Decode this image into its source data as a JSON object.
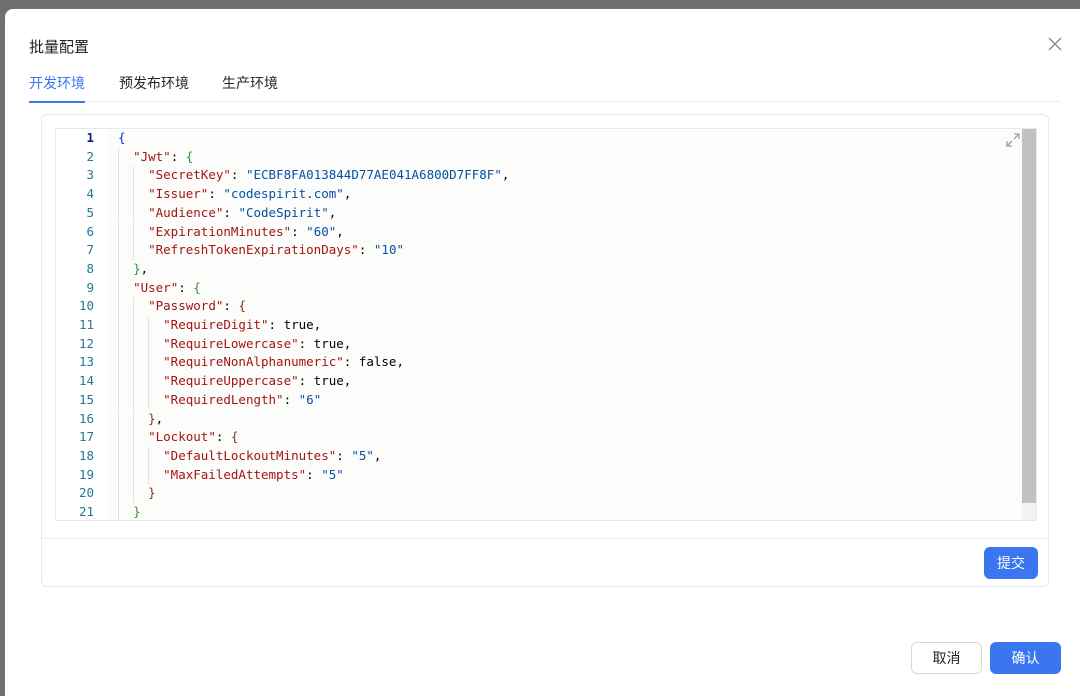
{
  "dialog": {
    "title": "批量配置",
    "close_icon": "close-icon"
  },
  "tabs": [
    {
      "label": "开发环境",
      "active": true
    },
    {
      "label": "预发布环境",
      "active": false
    },
    {
      "label": "生产环境",
      "active": false
    }
  ],
  "editor": {
    "language": "json",
    "expand_icon": "expand-icon",
    "line_numbers": [
      "1",
      "2",
      "3",
      "4",
      "5",
      "6",
      "7",
      "8",
      "9",
      "10",
      "11",
      "12",
      "13",
      "14",
      "15",
      "16",
      "17",
      "18",
      "19",
      "20",
      "21"
    ],
    "lines": [
      "{",
      "  \"Jwt\": {",
      "    \"SecretKey\": \"ECBF8FA013844D77AE041A6800D7FF8F\",",
      "    \"Issuer\": \"codespirit.com\",",
      "    \"Audience\": \"CodeSpirit\",",
      "    \"ExpirationMinutes\": \"60\",",
      "    \"RefreshTokenExpirationDays\": \"10\"",
      "  },",
      "  \"User\": {",
      "    \"Password\": {",
      "      \"RequireDigit\": true,",
      "      \"RequireLowercase\": true,",
      "      \"RequireNonAlphanumeric\": false,",
      "      \"RequireUppercase\": true,",
      "      \"RequiredLength\": \"6\"",
      "    },",
      "    \"Lockout\": {",
      "      \"DefaultLockoutMinutes\": \"5\",",
      "      \"MaxFailedAttempts\": \"5\"",
      "    }",
      "  }"
    ]
  },
  "card": {
    "submit_label": "提交"
  },
  "footer": {
    "cancel_label": "取消",
    "confirm_label": "确认"
  },
  "colors": {
    "primary": "#3a76f0",
    "json_key": "#a31515",
    "json_string": "#0451a5",
    "json_literal": "#0451a5",
    "line_number": "#237893"
  }
}
